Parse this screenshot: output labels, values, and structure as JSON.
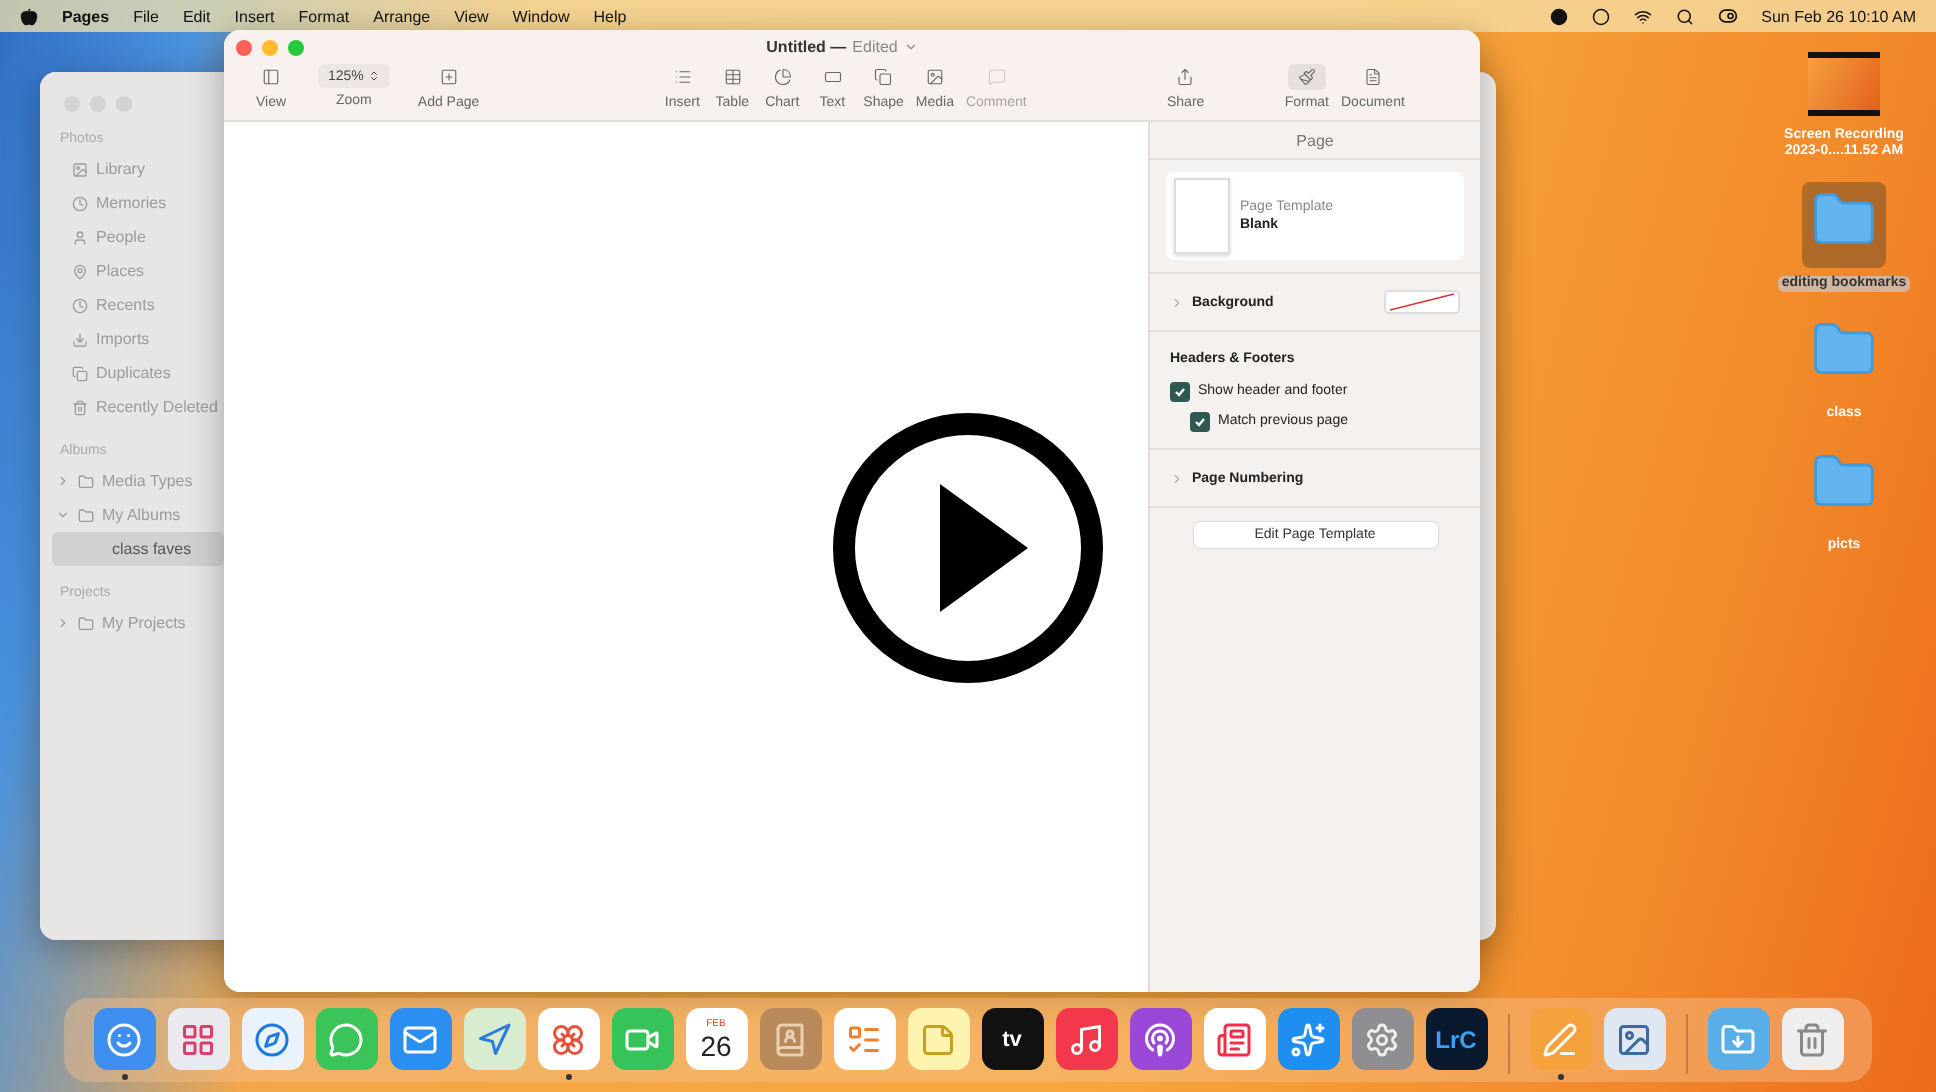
{
  "menu_bar": {
    "app": "Pages",
    "menus": [
      "File",
      "Edit",
      "Insert",
      "Format",
      "Arrange",
      "View",
      "Window",
      "Help"
    ],
    "clock": "Sun Feb 26  10:10 AM"
  },
  "photos_window": {
    "sections": [
      {
        "title": "Photos",
        "items": [
          {
            "label": "Library",
            "selected": false
          },
          {
            "label": "Memories",
            "selected": false
          },
          {
            "label": "People",
            "selected": false
          },
          {
            "label": "Places",
            "selected": false
          },
          {
            "label": "Recents",
            "selected": false
          },
          {
            "label": "Imports",
            "selected": false
          },
          {
            "label": "Duplicates",
            "selected": false
          },
          {
            "label": "Recently Deleted",
            "selected": false
          }
        ]
      },
      {
        "title": "Albums",
        "items": [
          {
            "label": "Media Types",
            "selected": false,
            "expanded": false
          },
          {
            "label": "My Albums",
            "selected": false,
            "expanded": true,
            "children": [
              {
                "label": "class faves",
                "selected": true
              }
            ]
          }
        ]
      },
      {
        "title": "Projects",
        "items": [
          {
            "label": "My Projects",
            "selected": false,
            "expanded": false
          }
        ]
      }
    ]
  },
  "pages_window": {
    "title": "Untitled —",
    "status": "Edited",
    "toolbar": [
      {
        "items": [
          {
            "label": "View",
            "kind": "button",
            "disabled": false,
            "selected": false
          },
          {
            "label": "Zoom",
            "kind": "dropdown",
            "value": "125%",
            "disabled": false,
            "selected": false
          },
          {
            "label": "Add Page",
            "kind": "button",
            "disabled": false,
            "selected": false
          }
        ]
      },
      {
        "items": [
          {
            "label": "Insert",
            "kind": "button",
            "disabled": false,
            "selected": false
          },
          {
            "label": "Table",
            "kind": "button",
            "disabled": false,
            "selected": false
          },
          {
            "label": "Chart",
            "kind": "button",
            "disabled": false,
            "selected": false
          },
          {
            "label": "Text",
            "kind": "button",
            "disabled": false,
            "selected": false
          },
          {
            "label": "Shape",
            "kind": "button",
            "disabled": false,
            "selected": false
          },
          {
            "label": "Media",
            "kind": "button",
            "disabled": false,
            "selected": false
          },
          {
            "label": "Comment",
            "kind": "button",
            "disabled": true,
            "selected": false
          }
        ]
      },
      {
        "items": [
          {
            "label": "Share",
            "kind": "button",
            "disabled": false,
            "selected": false
          }
        ]
      },
      {
        "items": [
          {
            "label": "Format",
            "kind": "button",
            "disabled": false,
            "selected": true
          },
          {
            "label": "Document",
            "kind": "button",
            "disabled": false,
            "selected": false
          }
        ]
      }
    ],
    "inspector": {
      "tab": "Page",
      "template_label": "Page Template",
      "template_name": "Blank",
      "background_label": "Background",
      "headers_title": "Headers & Footers",
      "checkboxes": [
        {
          "label": "Show header and footer",
          "checked": true
        },
        {
          "label": "Match previous page",
          "checked": true
        }
      ],
      "numbering_label": "Page Numbering",
      "button": "Edit Page Template"
    }
  },
  "desktop_icons": [
    {
      "label": "Screen Recording\n2023-0....11.52 AM",
      "kind": "video",
      "selected": false
    },
    {
      "label": "editing bookmarks",
      "kind": "folder",
      "selected": true
    },
    {
      "label": "class",
      "kind": "folder",
      "selected": false
    },
    {
      "label": "picts",
      "kind": "folder",
      "selected": false
    }
  ],
  "video": {
    "paused": true
  },
  "dock": [
    {
      "kind": "finder",
      "running": true
    },
    {
      "kind": "launchpad",
      "running": false
    },
    {
      "kind": "safari",
      "running": false
    },
    {
      "kind": "messages",
      "running": false
    },
    {
      "kind": "mail",
      "running": false
    },
    {
      "kind": "maps",
      "running": false
    },
    {
      "kind": "photos",
      "running": true
    },
    {
      "kind": "facetime",
      "running": false
    },
    {
      "kind": "calendar",
      "month": "FEB",
      "day": "26",
      "running": false
    },
    {
      "kind": "contacts",
      "running": false
    },
    {
      "kind": "reminders",
      "running": false
    },
    {
      "kind": "notes",
      "running": false
    },
    {
      "kind": "tv",
      "text": "tv",
      "running": false
    },
    {
      "kind": "music",
      "running": false
    },
    {
      "kind": "podcasts",
      "running": false
    },
    {
      "kind": "news",
      "running": false
    },
    {
      "kind": "appstore",
      "running": false
    },
    {
      "kind": "settings",
      "running": false
    },
    {
      "kind": "lightroom",
      "text": "LrC",
      "running": false
    },
    {
      "kind": "separator"
    },
    {
      "kind": "pages",
      "running": true
    },
    {
      "kind": "preview",
      "running": false
    },
    {
      "kind": "separator"
    },
    {
      "kind": "downloads",
      "running": false
    },
    {
      "kind": "trash",
      "running": false
    }
  ]
}
